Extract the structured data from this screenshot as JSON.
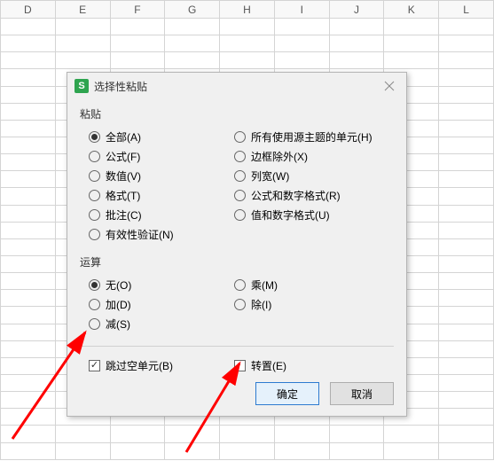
{
  "columns": [
    "D",
    "E",
    "F",
    "G",
    "H",
    "I",
    "J",
    "K",
    "L"
  ],
  "dialog": {
    "title": "选择性粘贴",
    "logo": "S",
    "section_paste": "粘贴",
    "section_operation": "运算",
    "paste_options": {
      "all": "全部(A)",
      "formulas": "公式(F)",
      "values": "数值(V)",
      "formats": "格式(T)",
      "comments": "批注(C)",
      "validation": "有效性验证(N)",
      "theme": "所有使用源主题的单元(H)",
      "borders_except": "边框除外(X)",
      "column_widths": "列宽(W)",
      "formula_number_formats": "公式和数字格式(R)",
      "value_number_formats": "值和数字格式(U)"
    },
    "operation_options": {
      "none": "无(O)",
      "add": "加(D)",
      "subtract": "减(S)",
      "multiply": "乘(M)",
      "divide": "除(I)"
    },
    "skip_blanks": "跳过空单元(B)",
    "transpose": "转置(E)",
    "ok": "确定",
    "cancel": "取消",
    "selected_paste": "all",
    "selected_operation": "none",
    "skip_blanks_checked": true,
    "transpose_checked": false
  }
}
